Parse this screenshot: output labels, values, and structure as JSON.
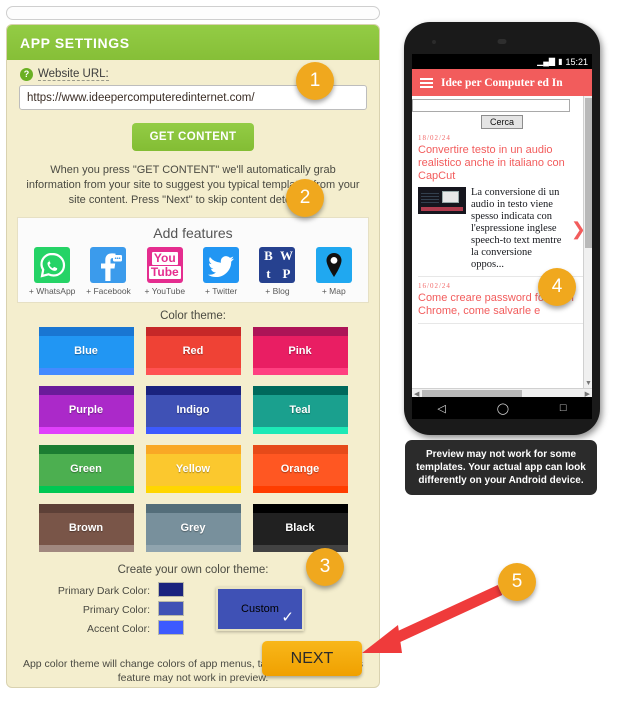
{
  "panel": {
    "header_title": "APP SETTINGS",
    "help_icon": "question-mark-icon",
    "url_label": "Website URL:",
    "url_value": "https://www.ideepercomputeredinternet.com/",
    "url_placeholder": "https://",
    "get_content_label": "GET CONTENT",
    "instructions": "When you press \"GET CONTENT\" we'll automatically grab information from your site to suggest you typical templates from your site content. Press \"Next\" to skip content detection.",
    "next_label": "NEXT"
  },
  "features": {
    "title": "Add features",
    "items": [
      {
        "label": "+ WhatsApp",
        "icon": "whatsapp-icon",
        "color": "#25d366"
      },
      {
        "label": "+ Facebook",
        "icon": "facebook-icon",
        "color": "#3b9bec"
      },
      {
        "label": "+ YouTube",
        "icon": "youtube-icon",
        "color": "#e52d8f",
        "line1": "You",
        "line2": "Tube"
      },
      {
        "label": "+ Twitter",
        "icon": "twitter-icon",
        "color": "#2196f3"
      },
      {
        "label": "+ Blog",
        "icon": "blog-icon",
        "color": "#26418f",
        "letters": [
          "B",
          "W",
          "t",
          "P"
        ]
      },
      {
        "label": "+ Map",
        "icon": "map-pin-icon",
        "color": "#20a8f0"
      }
    ]
  },
  "theme": {
    "section_label": "Color theme:",
    "custom_section_label": "Create your own color theme:",
    "swatches": [
      {
        "name": "Blue",
        "dark": "#1976d2",
        "main": "#2196f3",
        "accent": "#448aff"
      },
      {
        "name": "Red",
        "dark": "#c62828",
        "main": "#ef4235",
        "accent": "#ff5252"
      },
      {
        "name": "Pink",
        "dark": "#ad1457",
        "main": "#e91e63",
        "accent": "#ff4081"
      },
      {
        "name": "Purple",
        "dark": "#6a1b9a",
        "main": "#ab29c9",
        "accent": "#e040fb"
      },
      {
        "name": "Indigo",
        "dark": "#1a237e",
        "main": "#3f51b5",
        "accent": "#3d5afe"
      },
      {
        "name": "Teal",
        "dark": "#00695c",
        "main": "#1aa08e",
        "accent": "#1de9b6"
      },
      {
        "name": "Green",
        "dark": "#1b7d32",
        "main": "#4caf50",
        "accent": "#00c853"
      },
      {
        "name": "Yellow",
        "dark": "#f9a825",
        "main": "#fbc82e",
        "accent": "#ffd600"
      },
      {
        "name": "Orange",
        "dark": "#e64a19",
        "main": "#ff5722",
        "accent": "#ff3d00"
      },
      {
        "name": "Brown",
        "dark": "#5d4037",
        "main": "#795548",
        "accent": "#a1887f"
      },
      {
        "name": "Grey",
        "dark": "#546e7a",
        "main": "#78909c",
        "accent": "#90a4ae"
      },
      {
        "name": "Black",
        "dark": "#000000",
        "main": "#212121",
        "accent": "#424242"
      }
    ],
    "custom_labels": [
      "Primary Dark Color:",
      "Primary Color:",
      "Accent Color:"
    ],
    "custom_colors": [
      "#1a237e",
      "#3f51b5",
      "#3d5afe"
    ],
    "custom_swatch_label": "Custom",
    "custom_selected": true,
    "check_icon": "check-icon",
    "note": "App color theme will change colors of app menus, tabs and controls. This feature may not work in preview."
  },
  "phone": {
    "status_time": "15:21",
    "status_icons": [
      "signal-icon",
      "battery-icon"
    ],
    "app_title": "Idee per Computer ed In",
    "menu_icon": "hamburger-icon",
    "search_value": "",
    "search_button_label": "Cerca",
    "posts": [
      {
        "date": "18/02/24",
        "title": "Convertire testo in un audio realistico anche in italiano con CapCut",
        "excerpt": "La conversione di un audio in testo viene spesso indicata con l'espressione inglese speech-to text mentre la conversione oppos...",
        "chevron": "chevron-right-icon"
      },
      {
        "date": "16/02/24",
        "title": "Come creare password forti con Chrome, come salvarle e"
      }
    ],
    "nav_icons": [
      "back-triangle-icon",
      "home-circle-icon",
      "recents-square-icon"
    ],
    "preview_note": "Preview may not work for some templates. Your actual app can look differently on your Android device."
  },
  "annotations": {
    "badges": [
      "1",
      "2",
      "3",
      "4",
      "5"
    ],
    "badge_color": "#f0a81e",
    "arrow_color": "#ef3b3b",
    "arrow_icon": "arrow-pointing-to-next-button"
  }
}
